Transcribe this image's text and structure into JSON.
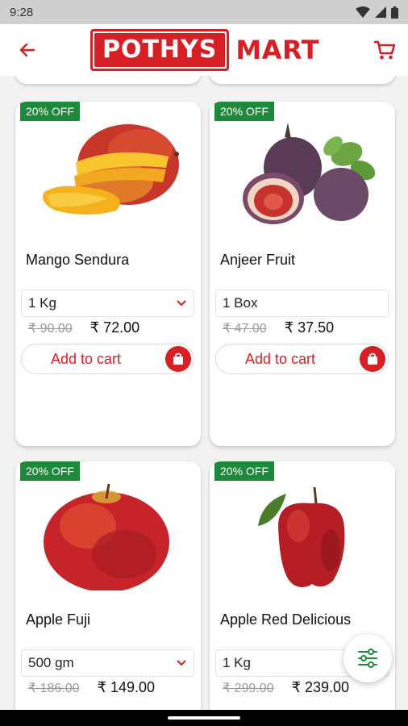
{
  "status_bar": {
    "time": "9:28"
  },
  "header": {
    "brand": "POTHYS",
    "brand_suffix": "MART"
  },
  "colors": {
    "brand_red": "#d71f26",
    "badge_green": "#1d8a3b",
    "filter_green": "#1d8a3b"
  },
  "products": [
    {
      "discount": "20% OFF",
      "name": "Mango Sendura",
      "unit": "1 Kg",
      "has_dropdown": true,
      "old_price": "₹ 90.00",
      "new_price": "₹ 72.00",
      "add_label": "Add to cart",
      "image": "mango-image"
    },
    {
      "discount": "20% OFF",
      "name": "Anjeer Fruit",
      "unit": "1 Box",
      "has_dropdown": false,
      "old_price": "₹ 47.00",
      "new_price": "₹ 37.50",
      "add_label": "Add to cart",
      "image": "fig-image"
    },
    {
      "discount": "20% OFF",
      "name": "Apple Fuji",
      "unit": "500 gm",
      "has_dropdown": true,
      "old_price": "₹ 186.00",
      "new_price": "₹ 149.00",
      "image": "apple-image"
    },
    {
      "discount": "20% OFF",
      "name": "Apple Red Delicious",
      "unit": "1 Kg",
      "has_dropdown": false,
      "old_price": "₹ 299.00",
      "new_price": "₹ 239.00",
      "image": "apple-red-delicious-image"
    }
  ],
  "icons": {
    "back": "arrow-left-icon",
    "cart": "cart-icon",
    "bag": "shopping-bag-icon",
    "filter": "filter-sliders-icon",
    "dropdown": "chevron-down-icon"
  }
}
